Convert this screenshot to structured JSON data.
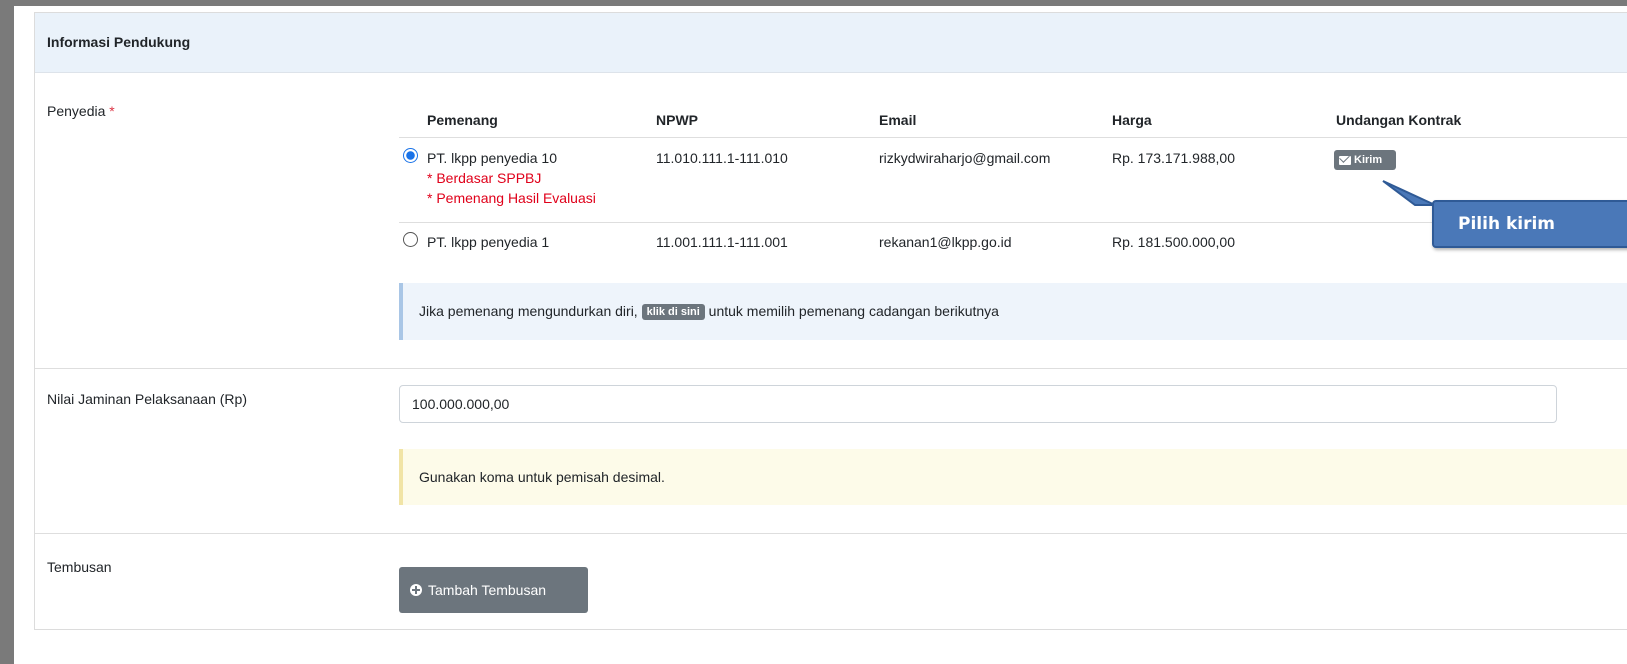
{
  "section": {
    "title": "Informasi Pendukung"
  },
  "penyedia": {
    "label": "Penyedia",
    "required_mark": "*",
    "columns": [
      "Pemenang",
      "NPWP",
      "Email",
      "Harga",
      "Undangan Kontrak"
    ],
    "rows": [
      {
        "name": "PT. lkpp penyedia 10",
        "selected": true,
        "notes": [
          "* Berdasar SPPBJ",
          "* Pemenang Hasil Evaluasi"
        ],
        "npwp": "11.010.111.1-111.010",
        "email": "rizkydwiraharjo@gmail.com",
        "harga": "Rp. 173.171.988,00",
        "action_label": "Kirim"
      },
      {
        "name": "PT. lkpp penyedia 1",
        "selected": false,
        "notes": [],
        "npwp": "11.001.111.1-111.001",
        "email": "rekanan1@lkpp.go.id",
        "harga": "Rp. 181.500.000,00",
        "action_label": ""
      }
    ],
    "info_before": "Jika pemenang mengundurkan diri,",
    "info_link": "klik di sini",
    "info_after": "untuk memilih pemenang cadangan berikutnya"
  },
  "callout": {
    "text": "Pilih kirim"
  },
  "jaminan": {
    "label": "Nilai Jaminan Pelaksanaan (Rp)",
    "value": "100.000.000,00",
    "hint": "Gunakan koma untuk pemisah desimal."
  },
  "tembusan": {
    "label": "Tembusan",
    "button_label": "Tambah Tembusan"
  },
  "colors": {
    "header_bg": "#eaf2fa",
    "required": "#dc3545",
    "note_red": "#e0001a",
    "button_gray": "#6c757d",
    "callout_blue": "#4a78b8"
  }
}
